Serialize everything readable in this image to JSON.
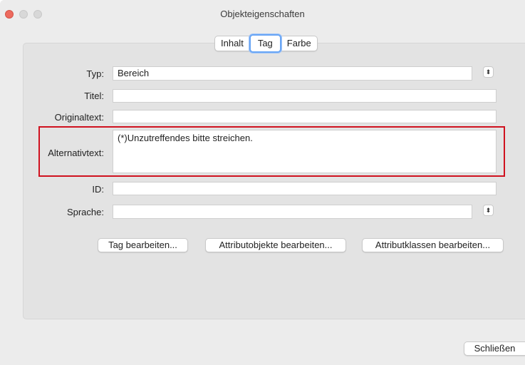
{
  "window": {
    "title": "Objekteigenschaften"
  },
  "tabs": [
    {
      "label": "Inhalt"
    },
    {
      "label": "Tag",
      "active": true
    },
    {
      "label": "Farbe"
    }
  ],
  "form": {
    "typ": {
      "label": "Typ:",
      "value": "Bereich"
    },
    "titel": {
      "label": "Titel:",
      "value": ""
    },
    "originaltext": {
      "label": "Originaltext:",
      "value": ""
    },
    "alternativtext": {
      "label": "Alternativtext:",
      "value": "(*)Unzutreffendes bitte streichen."
    },
    "id": {
      "label": "ID:",
      "value": ""
    },
    "sprache": {
      "label": "Sprache:",
      "value": ""
    }
  },
  "buttons": {
    "tag_bearbeiten": "Tag bearbeiten...",
    "attributobjekte": "Attributobjekte bearbeiten...",
    "attributklassen": "Attributklassen bearbeiten...",
    "schliessen": "Schließen"
  },
  "icons": {
    "stepper": "up-down-chevron-icon"
  },
  "colors": {
    "highlight": "#d0121f",
    "active_tab_ring": "#6aa6f5"
  }
}
